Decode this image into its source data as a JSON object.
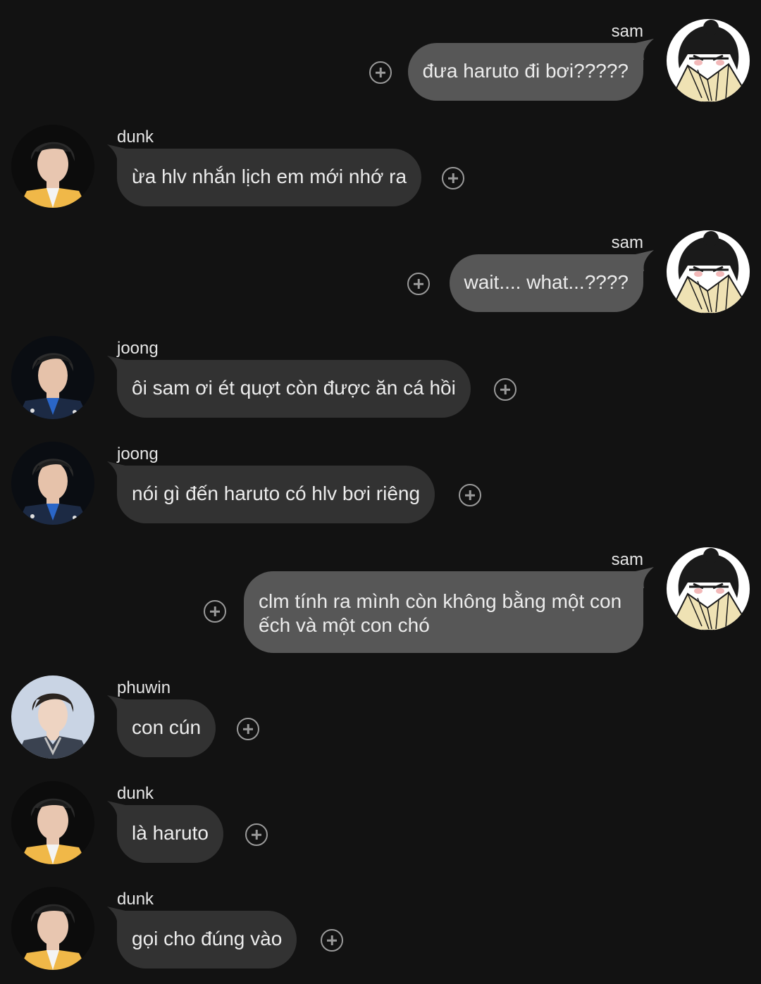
{
  "messages": [
    {
      "side": "right",
      "sender": "sam",
      "text": "đưa haruto đi bơi?????",
      "avatar": "anime-fan-avatar"
    },
    {
      "side": "left",
      "sender": "dunk",
      "text": "ừa hlv nhắn lịch em mới nhớ ra",
      "avatar": "dunk-avatar"
    },
    {
      "side": "right",
      "sender": "sam",
      "text": "wait.... what...????",
      "avatar": "anime-fan-avatar"
    },
    {
      "side": "left",
      "sender": "joong",
      "text": "ôi sam ơi ét quợt còn được ăn cá hồi",
      "avatar": "joong-avatar"
    },
    {
      "side": "left",
      "sender": "joong",
      "text": "nói gì đến haruto có hlv bơi riêng",
      "avatar": "joong-avatar"
    },
    {
      "side": "right",
      "sender": "sam",
      "text": "clm tính ra mình còn không bằng một con ếch và một con chó",
      "avatar": "anime-fan-avatar"
    },
    {
      "side": "left",
      "sender": "phuwin",
      "text": "con cún",
      "avatar": "phuwin-avatar"
    },
    {
      "side": "left",
      "sender": "dunk",
      "text": "là haruto",
      "avatar": "dunk-avatar"
    },
    {
      "side": "left",
      "sender": "dunk",
      "text": "gọi cho đúng vào",
      "avatar": "dunk-avatar"
    }
  ],
  "colors": {
    "background": "#121212",
    "bubble_incoming": "#323232",
    "bubble_outgoing": "#575757",
    "text": "#ececec",
    "icon": "#9a9a9a"
  },
  "icons": {
    "react": "plus-circle-icon"
  }
}
